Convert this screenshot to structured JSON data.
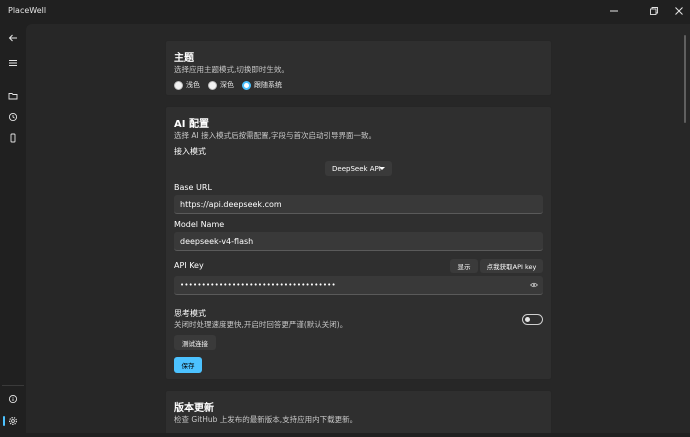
{
  "window": {
    "title": "PlaceWell"
  },
  "theme": {
    "title": "主题",
    "description": "选择应用主题模式,切换即时生效。",
    "options": [
      {
        "label": "浅色",
        "checked": false
      },
      {
        "label": "深色",
        "checked": false
      },
      {
        "label": "跟随系统",
        "checked": true
      }
    ]
  },
  "ai": {
    "title": "AI 配置",
    "description": "选择 AI 接入模式后按需配置,字段与首次启动引导界面一致。",
    "mode_label": "接入模式",
    "mode_value": "DeepSeek API",
    "base_url_label": "Base URL",
    "base_url_value": "https://api.deepseek.com",
    "model_label": "Model Name",
    "model_value": "deepseek-v4-flash",
    "api_key_label": "API Key",
    "show_button": "显示",
    "get_key_button": "点我获取API key",
    "api_key_masked": "••••••••••••••••••••••••••••••••••••",
    "thinking_label": "思考模式",
    "thinking_desc": "关闭时处理速度更快,开启时回答更严谨(默认关闭)。",
    "thinking_enabled": false,
    "test_button": "测试连接",
    "save_button": "保存"
  },
  "update": {
    "title": "版本更新",
    "description": "检查 GitHub 上发布的最新版本,支持应用内下载更新。"
  },
  "icons": {
    "back": "back-arrow-icon",
    "menu": "hamburger-menu-icon",
    "folder": "folder-icon",
    "history": "history-icon",
    "device": "phone-icon",
    "info": "info-icon",
    "settings": "gear-icon",
    "minimize": "minimize-icon",
    "restore": "restore-icon",
    "close": "close-icon",
    "eye": "eye-icon"
  },
  "colors": {
    "accent": "#4cc2ff",
    "background": "#202020",
    "card": "#2f2f2f"
  }
}
